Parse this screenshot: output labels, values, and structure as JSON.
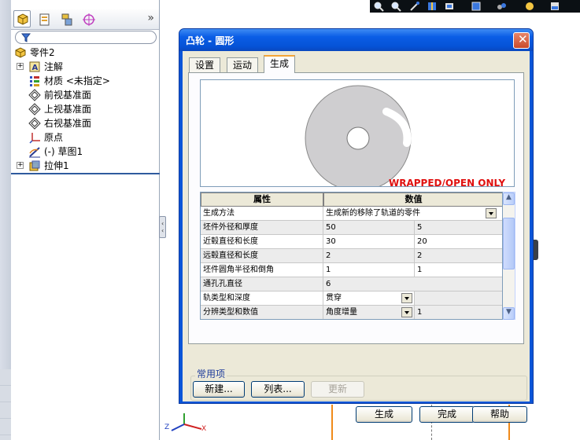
{
  "tree": {
    "root": "零件2",
    "items": [
      {
        "label": "注解",
        "expandable": true
      },
      {
        "label": "材质 <未指定>",
        "expandable": false
      },
      {
        "label": "前视基准面",
        "expandable": false
      },
      {
        "label": "上视基准面",
        "expandable": false
      },
      {
        "label": "右视基准面",
        "expandable": false
      },
      {
        "label": "原点",
        "expandable": false
      },
      {
        "label": "(-) 草图1",
        "expandable": false
      },
      {
        "label": "拉伸1",
        "expandable": true
      }
    ],
    "collapse_glyph": "»"
  },
  "dialog": {
    "title": "凸轮 - 圆形",
    "close_glyph": "✕",
    "tabs": [
      {
        "label": "设置",
        "active": false
      },
      {
        "label": "运动",
        "active": false
      },
      {
        "label": "生成",
        "active": true
      }
    ],
    "preview_caption": "WRAPPED/OPEN ONLY",
    "grid": {
      "headers": [
        "属性",
        "数值"
      ],
      "rows": [
        {
          "prop": "生成方法",
          "v1": "生成新的移除了轨道的零件",
          "v2": "",
          "dropdown": true
        },
        {
          "prop": "坯件外径和厚度",
          "v1": "50",
          "v2": "5"
        },
        {
          "prop": "近毂直径和长度",
          "v1": "30",
          "v2": "20"
        },
        {
          "prop": "远毂直径和长度",
          "v1": "2",
          "v2": "2"
        },
        {
          "prop": "坯件圆角半径和倒角",
          "v1": "1",
          "v2": "1"
        },
        {
          "prop": "通孔孔直径",
          "v1": "6",
          "v2": ""
        },
        {
          "prop": "轨类型和深度",
          "v1": "贯穿",
          "v2": "",
          "dropdown": true
        },
        {
          "prop": "分辨类型和数值",
          "v1": "角度增量",
          "v2": "1",
          "dropdown": true
        }
      ]
    },
    "common": {
      "title": "常用项",
      "new_label": "新建...",
      "list_label": "列表...",
      "update_label": "更新"
    },
    "footer": {
      "create_label": "生成",
      "done_label": "完成",
      "help_label": "帮助"
    }
  },
  "triad": {
    "z": "Z",
    "x": "X"
  },
  "colors": {
    "title_blue": "#0a55d8",
    "dialog_face": "#ece9d8",
    "caption_red": "#e01010",
    "viewport_orange": "#f08a1a"
  }
}
